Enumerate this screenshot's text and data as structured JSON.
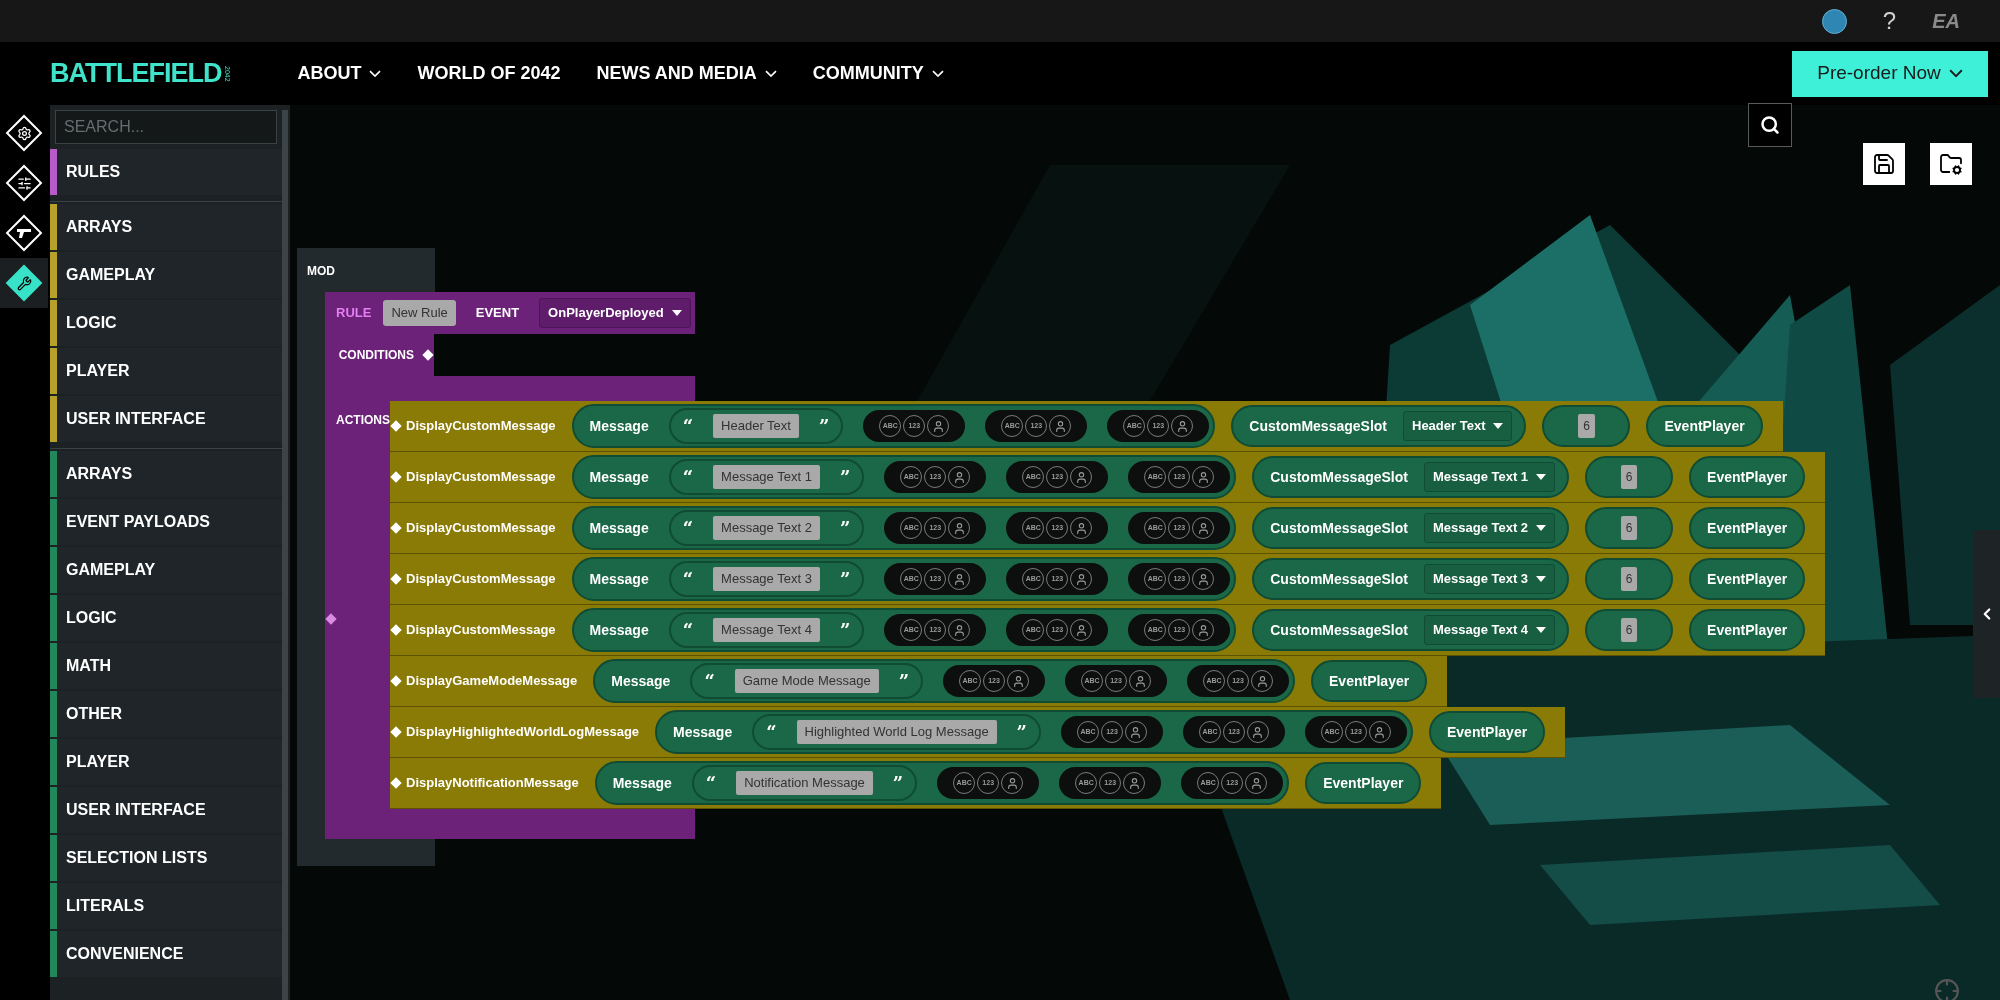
{
  "topbar": {
    "help": "?",
    "brand": "EA"
  },
  "nav": {
    "logo": "BATTLEFIELD",
    "logo_sub": "2042",
    "items": [
      {
        "label": "ABOUT",
        "has_menu": true
      },
      {
        "label": "WORLD OF 2042",
        "has_menu": false
      },
      {
        "label": "NEWS AND MEDIA",
        "has_menu": true
      },
      {
        "label": "COMMUNITY",
        "has_menu": true
      }
    ],
    "cta": "Pre-order Now"
  },
  "rail": [
    {
      "selected": false
    },
    {
      "selected": false
    },
    {
      "selected": false
    },
    {
      "selected": true
    }
  ],
  "sidebar": {
    "search_placeholder": "SEARCH...",
    "groups": [
      {
        "items": [
          {
            "label": "RULES",
            "color": "#b85bc8"
          }
        ]
      },
      {
        "items": [
          {
            "label": "ARRAYS",
            "color": "#b8a12a"
          },
          {
            "label": "GAMEPLAY",
            "color": "#b8a12a"
          },
          {
            "label": "LOGIC",
            "color": "#b8a12a"
          },
          {
            "label": "PLAYER",
            "color": "#b8a12a"
          },
          {
            "label": "USER INTERFACE",
            "color": "#b8a12a"
          }
        ]
      },
      {
        "items": [
          {
            "label": "ARRAYS",
            "color": "#22875a"
          },
          {
            "label": "EVENT PAYLOADS",
            "color": "#22875a"
          },
          {
            "label": "GAMEPLAY",
            "color": "#22875a"
          },
          {
            "label": "LOGIC",
            "color": "#22875a"
          },
          {
            "label": "MATH",
            "color": "#22875a"
          },
          {
            "label": "OTHER",
            "color": "#22875a"
          },
          {
            "label": "PLAYER",
            "color": "#22875a"
          },
          {
            "label": "USER INTERFACE",
            "color": "#22875a"
          },
          {
            "label": "SELECTION LISTS",
            "color": "#22875a"
          },
          {
            "label": "LITERALS",
            "color": "#22875a"
          },
          {
            "label": "CONVENIENCE",
            "color": "#22875a"
          }
        ]
      }
    ]
  },
  "canvas": {
    "mod_label": "MOD",
    "rule": {
      "label": "RULE",
      "name": "New Rule",
      "event_label": "EVENT",
      "event": "OnPlayerDeployed",
      "conditions_label": "CONDITIONS",
      "actions_label": "ACTIONS",
      "actions": [
        {
          "name": "DisplayCustomMessage",
          "args": [
            {
              "kind": "message",
              "label": "Message",
              "quotes": [
                "“",
                "”"
              ],
              "text": "Header Text",
              "slots": [
                [
                  "ABC",
                  "123"
                ],
                [
                  "ABC",
                  "123"
                ],
                [
                  "ABC",
                  "123"
                ]
              ]
            },
            {
              "kind": "slot",
              "label": "CustomMessageSlot",
              "value": "Header Text"
            },
            {
              "kind": "number",
              "value": "6"
            },
            {
              "kind": "player",
              "label": "EventPlayer"
            }
          ]
        },
        {
          "name": "DisplayCustomMessage",
          "args": [
            {
              "kind": "message",
              "label": "Message",
              "quotes": [
                "“",
                "”"
              ],
              "text": "Message Text 1",
              "slots": [
                [
                  "ABC",
                  "123"
                ],
                [
                  "ABC",
                  "123"
                ],
                [
                  "ABC",
                  "123"
                ]
              ]
            },
            {
              "kind": "slot",
              "label": "CustomMessageSlot",
              "value": "Message Text 1"
            },
            {
              "kind": "number",
              "value": "6"
            },
            {
              "kind": "player",
              "label": "EventPlayer"
            }
          ]
        },
        {
          "name": "DisplayCustomMessage",
          "args": [
            {
              "kind": "message",
              "label": "Message",
              "quotes": [
                "“",
                "”"
              ],
              "text": "Message Text 2",
              "slots": [
                [
                  "ABC",
                  "123"
                ],
                [
                  "ABC",
                  "123"
                ],
                [
                  "ABC",
                  "123"
                ]
              ]
            },
            {
              "kind": "slot",
              "label": "CustomMessageSlot",
              "value": "Message Text 2"
            },
            {
              "kind": "number",
              "value": "6"
            },
            {
              "kind": "player",
              "label": "EventPlayer"
            }
          ]
        },
        {
          "name": "DisplayCustomMessage",
          "args": [
            {
              "kind": "message",
              "label": "Message",
              "quotes": [
                "“",
                "”"
              ],
              "text": "Message Text 3",
              "slots": [
                [
                  "ABC",
                  "123"
                ],
                [
                  "ABC",
                  "123"
                ],
                [
                  "ABC",
                  "123"
                ]
              ]
            },
            {
              "kind": "slot",
              "label": "CustomMessageSlot",
              "value": "Message Text 3"
            },
            {
              "kind": "number",
              "value": "6"
            },
            {
              "kind": "player",
              "label": "EventPlayer"
            }
          ]
        },
        {
          "name": "DisplayCustomMessage",
          "args": [
            {
              "kind": "message",
              "label": "Message",
              "quotes": [
                "“",
                "”"
              ],
              "text": "Message Text 4",
              "slots": [
                [
                  "ABC",
                  "123"
                ],
                [
                  "ABC",
                  "123"
                ],
                [
                  "ABC",
                  "123"
                ]
              ]
            },
            {
              "kind": "slot",
              "label": "CustomMessageSlot",
              "value": "Message Text 4"
            },
            {
              "kind": "number",
              "value": "6"
            },
            {
              "kind": "player",
              "label": "EventPlayer"
            }
          ]
        },
        {
          "name": "DisplayGameModeMessage",
          "args": [
            {
              "kind": "message",
              "label": "Message",
              "quotes": [
                "“",
                "”"
              ],
              "text": "Game Mode Message",
              "slots": [
                [
                  "ABC",
                  "123"
                ],
                [
                  "ABC",
                  "123"
                ],
                [
                  "ABC",
                  "123"
                ]
              ]
            },
            {
              "kind": "player",
              "label": "EventPlayer"
            }
          ]
        },
        {
          "name": "DisplayHighlightedWorldLogMessage",
          "args": [
            {
              "kind": "message",
              "label": "Message",
              "quotes": [
                "“",
                "”"
              ],
              "text": "Highlighted World Log Message",
              "slots": [
                [
                  "ABC",
                  "123"
                ],
                [
                  "ABC",
                  "123"
                ],
                [
                  "ABC",
                  "123"
                ]
              ]
            },
            {
              "kind": "player",
              "label": "EventPlayer"
            }
          ]
        },
        {
          "name": "DisplayNotificationMessage",
          "args": [
            {
              "kind": "message",
              "label": "Message",
              "quotes": [
                "“",
                "”"
              ],
              "text": "Notification Message",
              "slots": [
                [
                  "ABC",
                  "123"
                ],
                [
                  "ABC",
                  "123"
                ],
                [
                  "ABC",
                  "123"
                ]
              ]
            },
            {
              "kind": "player",
              "label": "EventPlayer"
            }
          ]
        }
      ]
    }
  }
}
